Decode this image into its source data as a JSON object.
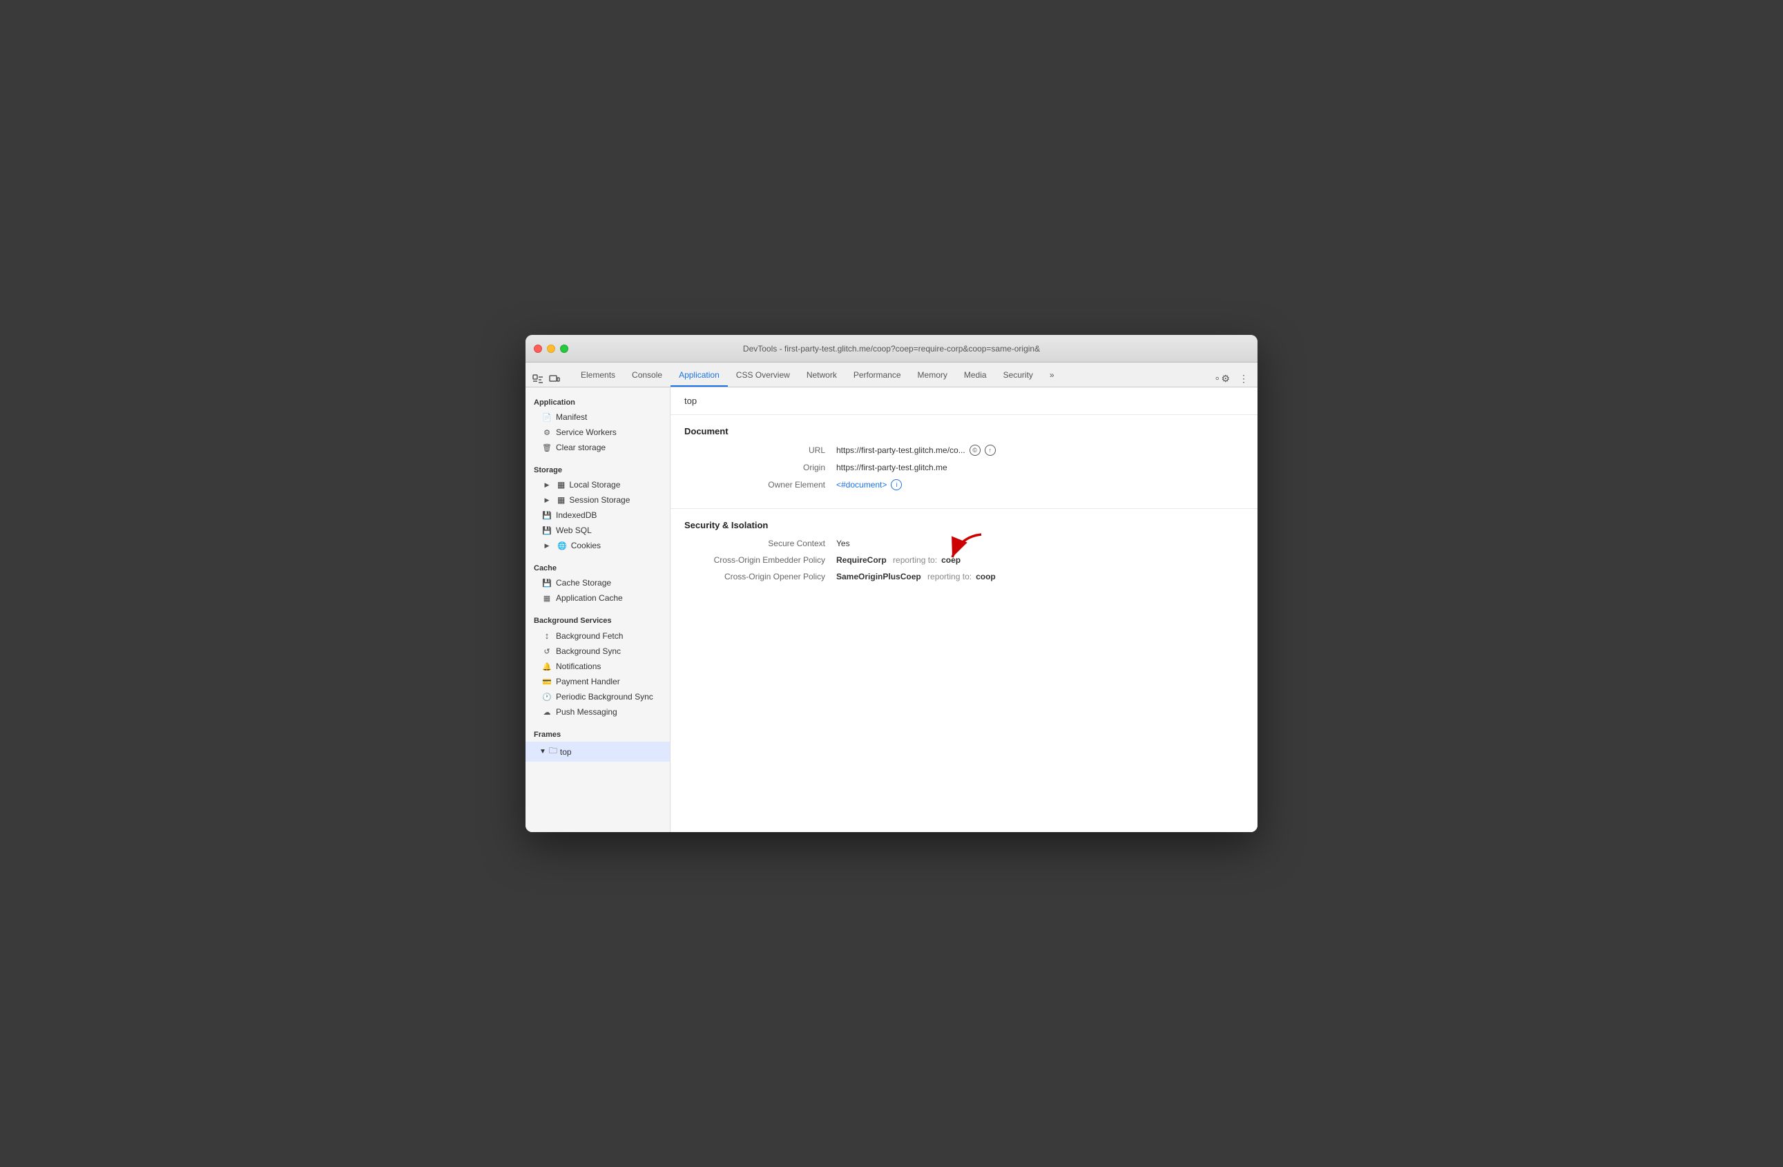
{
  "window": {
    "title": "DevTools - first-party-test.glitch.me/coop?coep=require-corp&coop=same-origin&"
  },
  "tabs": {
    "items": [
      {
        "label": "Elements",
        "active": false
      },
      {
        "label": "Console",
        "active": false
      },
      {
        "label": "Application",
        "active": true
      },
      {
        "label": "CSS Overview",
        "active": false
      },
      {
        "label": "Network",
        "active": false
      },
      {
        "label": "Performance",
        "active": false
      },
      {
        "label": "Memory",
        "active": false
      },
      {
        "label": "Media",
        "active": false
      },
      {
        "label": "Security",
        "active": false
      },
      {
        "label": "»",
        "active": false
      }
    ]
  },
  "sidebar": {
    "sections": {
      "application": {
        "title": "Application",
        "items": [
          {
            "label": "Manifest",
            "icon": "📄"
          },
          {
            "label": "Service Workers",
            "icon": "⚙"
          },
          {
            "label": "Clear storage",
            "icon": "🗑"
          }
        ]
      },
      "storage": {
        "title": "Storage",
        "items": [
          {
            "label": "Local Storage",
            "icon": "▶",
            "hasGrid": true,
            "expandable": true
          },
          {
            "label": "Session Storage",
            "icon": "▶",
            "hasGrid": true,
            "expandable": true
          },
          {
            "label": "IndexedDB",
            "icon": "💾"
          },
          {
            "label": "Web SQL",
            "icon": "💾"
          },
          {
            "label": "Cookies",
            "icon": "▶",
            "expandable": true
          }
        ]
      },
      "cache": {
        "title": "Cache",
        "items": [
          {
            "label": "Cache Storage",
            "icon": "💾"
          },
          {
            "label": "Application Cache",
            "icon": "▦"
          }
        ]
      },
      "backgroundServices": {
        "title": "Background Services",
        "items": [
          {
            "label": "Background Fetch",
            "icon": "↕"
          },
          {
            "label": "Background Sync",
            "icon": "↺"
          },
          {
            "label": "Notifications",
            "icon": "🔔"
          },
          {
            "label": "Payment Handler",
            "icon": "💳"
          },
          {
            "label": "Periodic Background Sync",
            "icon": "🕐"
          },
          {
            "label": "Push Messaging",
            "icon": "☁"
          }
        ]
      },
      "frames": {
        "title": "Frames",
        "items": [
          {
            "label": "top",
            "icon": "▼",
            "expanded": true
          }
        ]
      }
    }
  },
  "content": {
    "header": "top",
    "document": {
      "sectionTitle": "Document",
      "fields": [
        {
          "label": "URL",
          "value": "https://first-party-test.glitch.me/co...",
          "hasIcons": true
        },
        {
          "label": "Origin",
          "value": "https://first-party-test.glitch.me"
        },
        {
          "label": "Owner Element",
          "value": "<#document>",
          "isLink": true,
          "hasInfoIcon": true
        }
      ]
    },
    "security": {
      "sectionTitle": "Security & Isolation",
      "fields": [
        {
          "label": "Secure Context",
          "value": "Yes"
        },
        {
          "label": "Cross-Origin Embedder Policy",
          "valueBold": "RequireCorp",
          "valueExtra": "reporting to:",
          "valueCode": "coep",
          "hasRedArrow": true
        },
        {
          "label": "Cross-Origin Opener Policy",
          "valueBold": "SameOriginPlusCoep",
          "valueExtra": "reporting to:",
          "valueCode": "coop"
        }
      ]
    }
  }
}
